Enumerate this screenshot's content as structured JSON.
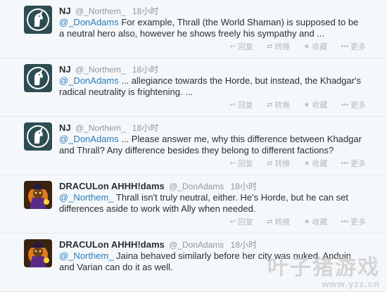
{
  "tweets": [
    {
      "name": "NJ",
      "handle": "@_Northem_",
      "time": "18小时",
      "mention": "@_DonAdams",
      "text": " For example, Thrall (the World Shaman) is supposed to be a neutral hero also, however he shows freely his sympathy and ...",
      "avatar_icon": "unicorn-avatar-icon"
    },
    {
      "name": "NJ",
      "handle": "@_Northem_",
      "time": "18小时",
      "mention": "@_DonAdams",
      "text": " ... allegiance towards the Horde, but instead, the Khadgar's radical neutrality is frightening. ...",
      "avatar_icon": "unicorn-avatar-icon"
    },
    {
      "name": "NJ",
      "handle": "@_Northem_",
      "time": "18小时",
      "mention": "@_DonAdams",
      "text": " ... Please answer me, why this difference between Khadgar and Thrall? Any difference besides they belong to different factions?",
      "avatar_icon": "unicorn-avatar-icon"
    },
    {
      "name": "DRACULon AHHH!dams",
      "handle": "@_DonAdams",
      "time": "18小时",
      "mention": "@_Northem_",
      "text": " Thrall isn't truly neutral, either. He's Horde, but he can set differences aside to work with Ally when needed.",
      "avatar_icon": "warlock-avatar-icon"
    },
    {
      "name": "DRACULon AHHH!dams",
      "handle": "@_DonAdams",
      "time": "18小时",
      "mention": "@_Northem_",
      "text": " Jaina behaved similarly before her city was nuked. Anduin and Varian can do it as well.",
      "avatar_icon": "warlock-avatar-icon"
    }
  ],
  "actions": {
    "reply": "回复",
    "retweet": "转推",
    "favorite": "收藏",
    "more": "更多"
  },
  "watermark": {
    "main": "叶子猪游戏",
    "url": "www.yzz.cn"
  },
  "colors": {
    "background": "#f5f8fa",
    "link": "#2b7bb9",
    "muted": "#8899a6"
  }
}
